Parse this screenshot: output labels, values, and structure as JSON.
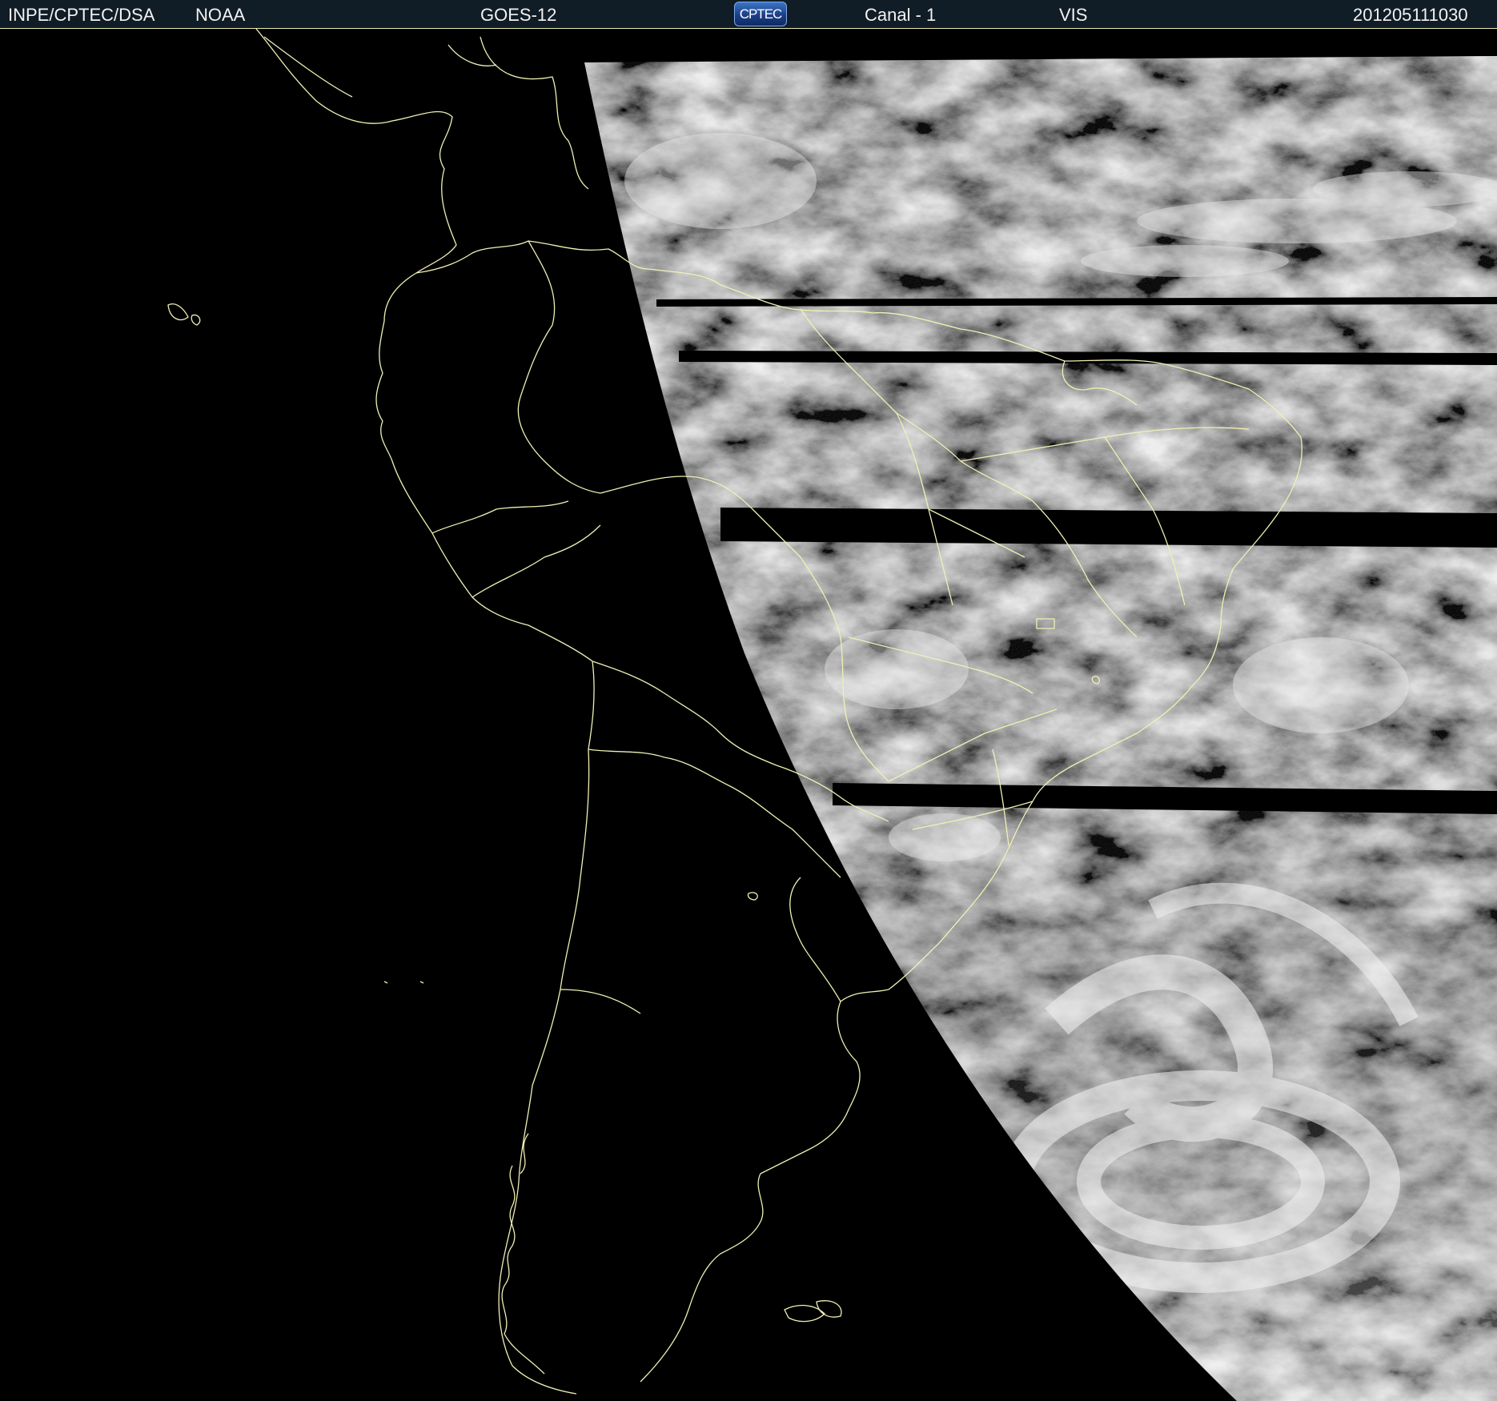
{
  "header": {
    "agency": "INPE/CPTEC/DSA",
    "source": "NOAA",
    "satellite": "GOES-12",
    "logo_text": "CPTEC",
    "channel": "Canal - 1",
    "band": "VIS",
    "timestamp": "201205111030"
  },
  "colors": {
    "header_bg": "#101c26",
    "coastline": "#f0f0b4",
    "space": "#000000"
  },
  "image": {
    "type": "satellite imagery",
    "illumination": "night side dark, day side visible",
    "region": "South America"
  }
}
